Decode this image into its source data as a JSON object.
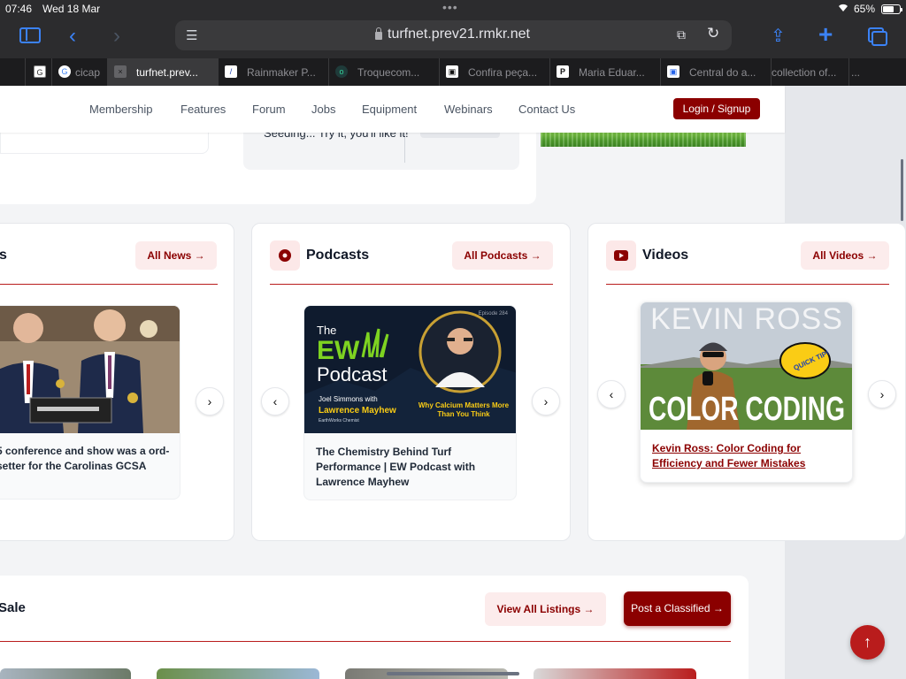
{
  "status": {
    "time": "07:46",
    "date": "Wed 18 Mar",
    "battery": "65%"
  },
  "browser": {
    "url": "turfnet.prev21.rmkr.net",
    "tabs": [
      {
        "label": "",
        "favicon": "G"
      },
      {
        "label": "cicap",
        "favicon": "G"
      },
      {
        "label": "turfnet.prev...",
        "favicon": "×"
      },
      {
        "label": "Rainmaker P...",
        "favicon": "/"
      },
      {
        "label": "Troquecom...",
        "favicon": "o"
      },
      {
        "label": "Confira peça...",
        "favicon": "▣"
      },
      {
        "label": "Maria Eduar...",
        "favicon": "P"
      },
      {
        "label": "Central do a...",
        "favicon": "▣"
      },
      {
        "label": "collection of...",
        "favicon": ""
      },
      {
        "label": "...",
        "favicon": ""
      }
    ]
  },
  "nav": {
    "links": [
      "Membership",
      "Features",
      "Forum",
      "Jobs",
      "Equipment",
      "Webinars",
      "Contact Us"
    ],
    "login": "Login / Signup"
  },
  "top": {
    "seeding_text": "Seeding... Try it, you'll like it!"
  },
  "news": {
    "title": "s",
    "link": "All News →",
    "caption": "5 conference and show was a ord-setter for the Carolinas GCSA"
  },
  "podcasts": {
    "title": "Podcasts",
    "link": "All Podcasts →",
    "image": {
      "episode": "Episode 284",
      "the": "The",
      "ew": "EW",
      "podcast": "Podcast",
      "host": "Joel Simmons with",
      "guest": "Lawrence Mayhew",
      "company": "EarthWorks Chemist",
      "tagline": "Why Calcium Matters More Than You Think"
    },
    "caption": "The Chemistry Behind Turf Performance | EW Podcast with Lawrence Mayhew"
  },
  "videos": {
    "title": "Videos",
    "link": "All Videos →",
    "image": {
      "name": "KEVIN ROSS",
      "headline": "COLOR CODING",
      "badge": "QUICK TIP!"
    },
    "caption": "Kevin Ross: Color Coding for Efficiency and Fewer Mistakes"
  },
  "classified": {
    "title": "Sale",
    "view_all": "View All Listings →",
    "post": "Post a Classified →"
  },
  "colors": {
    "brand": "#8b0000",
    "accent_bg": "#fcecec",
    "rule": "#b91c1c"
  }
}
